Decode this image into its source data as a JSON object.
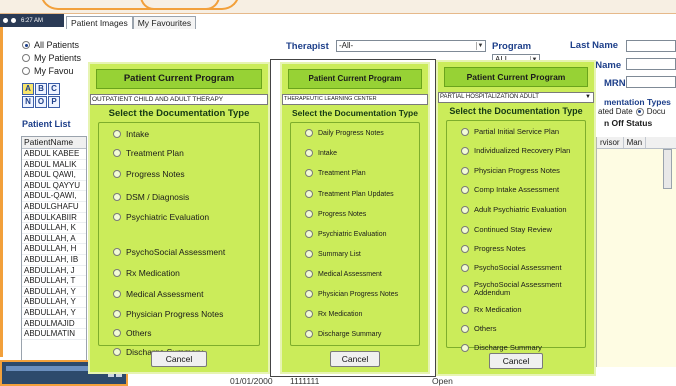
{
  "taskbar": {
    "time": "6:27 AM"
  },
  "tabs": [
    {
      "label": "Patient Images"
    },
    {
      "label": "My Favourites"
    }
  ],
  "filters": {
    "radios": [
      "All Patients",
      "My Patients",
      "My Favou"
    ],
    "alphabet_row1": [
      "A",
      "B",
      "C"
    ],
    "alphabet_row2": [
      "N",
      "O",
      "P"
    ],
    "patient_list_label": "Patient List"
  },
  "patient_grid": {
    "header": "PatientName",
    "rows": [
      "ABDUL KABEE",
      "ABDUL MALIK",
      "ABDUL QAWI,",
      "ABDUL QAYYU",
      "ABDUL-QAWI,",
      "ABDULGHAFU",
      "ABDULKABIIR",
      "ABDULLAH, K",
      "ABDULLAH, A",
      "ABDULLAH, H",
      "ABDULLAH, IB",
      "ABDULLAH, J",
      "ABDULLAH, T",
      "ABDULLAH, Y",
      "ABDULLAH, Y",
      "ABDULLAH, Y",
      "ABDULMAJID",
      "ABDULMATIN"
    ]
  },
  "header_fields": {
    "therapist_label": "Therapist",
    "therapist_value": "-All-",
    "program_label": "Program",
    "program_value": "ALL",
    "last_name_label": "Last Name",
    "first_name_label": "First Name",
    "mrn_label": "MRN"
  },
  "doc_types": {
    "label": "mentation Types",
    "line": "ated Date",
    "line2": "Docu",
    "onoff": "n Off Status"
  },
  "right_grid": {
    "headers": [
      "rvisor",
      "Man"
    ]
  },
  "bottom_row": {
    "date": "01/01/2000",
    "id": "1111111",
    "status": "Open"
  },
  "panels": [
    {
      "title": "Patient Current Program",
      "program": "OUTPATIENT CHILD AND ADULT THERAPY",
      "subtitle": "Select the Documentation Type",
      "options": [
        "Intake",
        "Treatment Plan",
        "Progress Notes",
        "DSM / Diagnosis",
        "Psychiatric Evaluation",
        "PsychoSocial Assessment",
        "Rx Medication",
        "Medical Assessment",
        "Physician Progress Notes",
        "Others",
        "Discharge Summary"
      ],
      "cancel": "Cancel"
    },
    {
      "title": "Patient Current Program",
      "program": "THERAPEUTIC LEARNING CENTER",
      "subtitle": "Select the Documentation Type",
      "options": [
        "Daily Progress Notes",
        "Intake",
        "Treatment Plan",
        "Treatment Plan Updates",
        "Progress Notes",
        "Psychiatric Evaluation",
        "Summary List",
        "Medical Assessment",
        "Physician Progress Notes",
        "Rx Medication",
        "Discharge Summary"
      ],
      "cancel": "Cancel"
    },
    {
      "title": "Patient Current Program",
      "program": "PARTIAL HOSPITALIZATION ADULT",
      "subtitle": "Select the Documentation Type",
      "options": [
        "Partial Initial Service Plan",
        "Individualized Recovery Plan",
        "Physician Progress Notes",
        "Comp Intake Assessment",
        "Adult Psychiatric Evaluation",
        "Continued Stay Review",
        "Progress Notes",
        "PsychoSocial Assessment",
        "PsychoSocial Assessment",
        "Rx Medication",
        "Others",
        "Discharge Summary"
      ],
      "option_extra": "Addendum",
      "cancel": "Cancel"
    }
  ]
}
